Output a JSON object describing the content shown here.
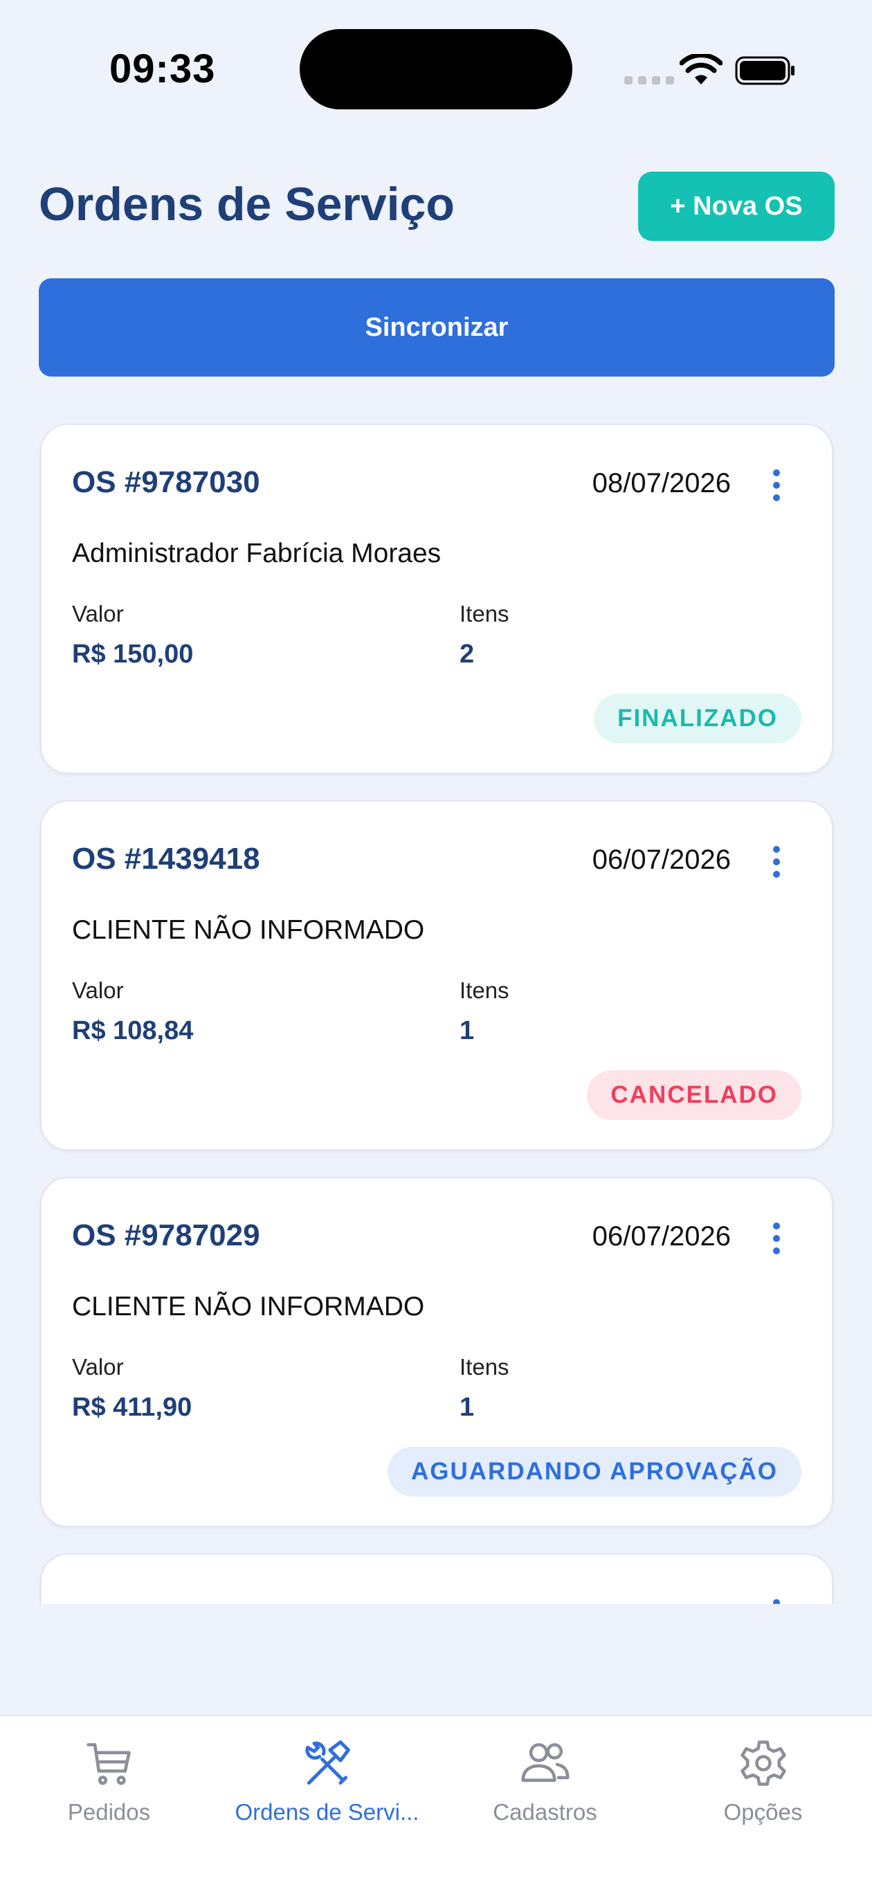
{
  "status_bar": {
    "time": "09:33"
  },
  "header": {
    "title": "Ordens de Serviço",
    "new_button": "+ Nova OS"
  },
  "sync_button": "Sincronizar",
  "orders": [
    {
      "number": "OS #9787030",
      "date": "08/07/2026",
      "client": "Administrador Fabrícia Moraes",
      "valor_label": "Valor",
      "valor": "R$ 150,00",
      "itens_label": "Itens",
      "itens": "2",
      "status": "FINALIZADO"
    },
    {
      "number": "OS #1439418",
      "date": "06/07/2026",
      "client": "CLIENTE NÃO INFORMADO",
      "valor_label": "Valor",
      "valor": "R$ 108,84",
      "itens_label": "Itens",
      "itens": "1",
      "status": "CANCELADO"
    },
    {
      "number": "OS #9787029",
      "date": "06/07/2026",
      "client": "CLIENTE NÃO INFORMADO",
      "valor_label": "Valor",
      "valor": "R$ 411,90",
      "itens_label": "Itens",
      "itens": "1",
      "status": "AGUARDANDO APROVAÇÃO"
    }
  ],
  "tabs": [
    {
      "label": "Pedidos",
      "icon": "cart-icon",
      "active": false
    },
    {
      "label": "Ordens de Servi...",
      "icon": "tools-icon",
      "active": true
    },
    {
      "label": "Cadastros",
      "icon": "users-icon",
      "active": false
    },
    {
      "label": "Opções",
      "icon": "gear-icon",
      "active": false
    }
  ],
  "colors": {
    "background": "#eef2fa",
    "primary": "#2f6fdb",
    "teal": "#14c1b3",
    "title": "#1f3f78",
    "status_finalizado": "#1bb9ab",
    "status_cancelado": "#ef3e5c",
    "status_aguardando": "#2f6fdb"
  }
}
